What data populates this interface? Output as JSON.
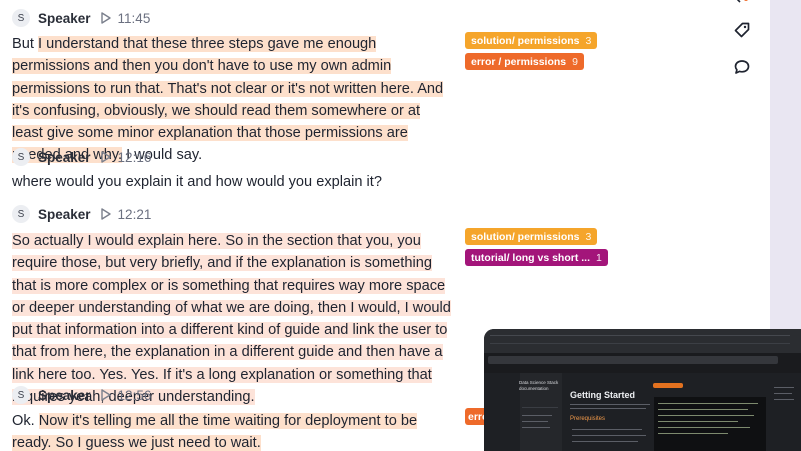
{
  "segments": [
    {
      "avatar": "S",
      "speaker": "Speaker",
      "time": "11:45",
      "parts": [
        {
          "text": "But ",
          "hl": false
        },
        {
          "text": "I understand that these three steps gave me enough permissions and then you don't have to use my own admin permissions to run that. That's not clear or it's not written here. And it's confusing, obviously, we should read them somewhere or at least give some minor explanation that those permissions are needed and why.",
          "hl": true
        },
        {
          "text": " I would say.",
          "hl": false
        }
      ]
    },
    {
      "avatar": "S",
      "speaker": "Speaker",
      "time": "12:16",
      "parts": [
        {
          "text": "where would you explain it and how would you explain it?",
          "hl": false
        }
      ]
    },
    {
      "avatar": "S",
      "speaker": "Speaker",
      "time": "12:21",
      "parts": [
        {
          "text": "So actually I would explain here. So in the section that you, you require those, but very briefly, and if the explanation is something that is more complex or is something that requires way more space or deeper understanding of what we are doing, then I would, I would put that information into a different kind of guide and link the user to that from here, the explanation in a different guide and then have a link here too. Yes. Yes. If it's a long explanation or something that requires yeah, deeper understanding.",
          "hl": true
        }
      ]
    },
    {
      "avatar": "S",
      "speaker": "Speaker",
      "time": "12:56",
      "parts": [
        {
          "text": "Ok. ",
          "hl": false
        },
        {
          "text": "Now it's telling me all the time waiting for deployment to be ready. So I guess we just need to wait.",
          "hl": true
        }
      ]
    }
  ],
  "tags": {
    "t1": {
      "label": "solution/ permissions",
      "count": "3",
      "color": "#f5a52b"
    },
    "t2": {
      "label": "error / permissions",
      "count": "9",
      "color": "#ee6a2a"
    },
    "t3": {
      "label": "solution/ permissions",
      "count": "3",
      "color": "#f5a52b"
    },
    "t4": {
      "label": "tutorial/ long vs short ...",
      "count": "1",
      "color": "#a3157a"
    },
    "t5": {
      "label": "erro",
      "count": "",
      "color": "#ee6a2a"
    }
  },
  "right_panel": {
    "icons": [
      "tag-icon",
      "comment-icon"
    ],
    "scrollbar_color": "#e9e6f2"
  },
  "video": {
    "doc_title": "Data Science Stack documentation",
    "heading": "Getting Started",
    "subheading": "Prerequisites"
  },
  "colors": {
    "highlight": "#fde0cc",
    "text": "#1f2430",
    "timestamp": "#6b7080"
  }
}
